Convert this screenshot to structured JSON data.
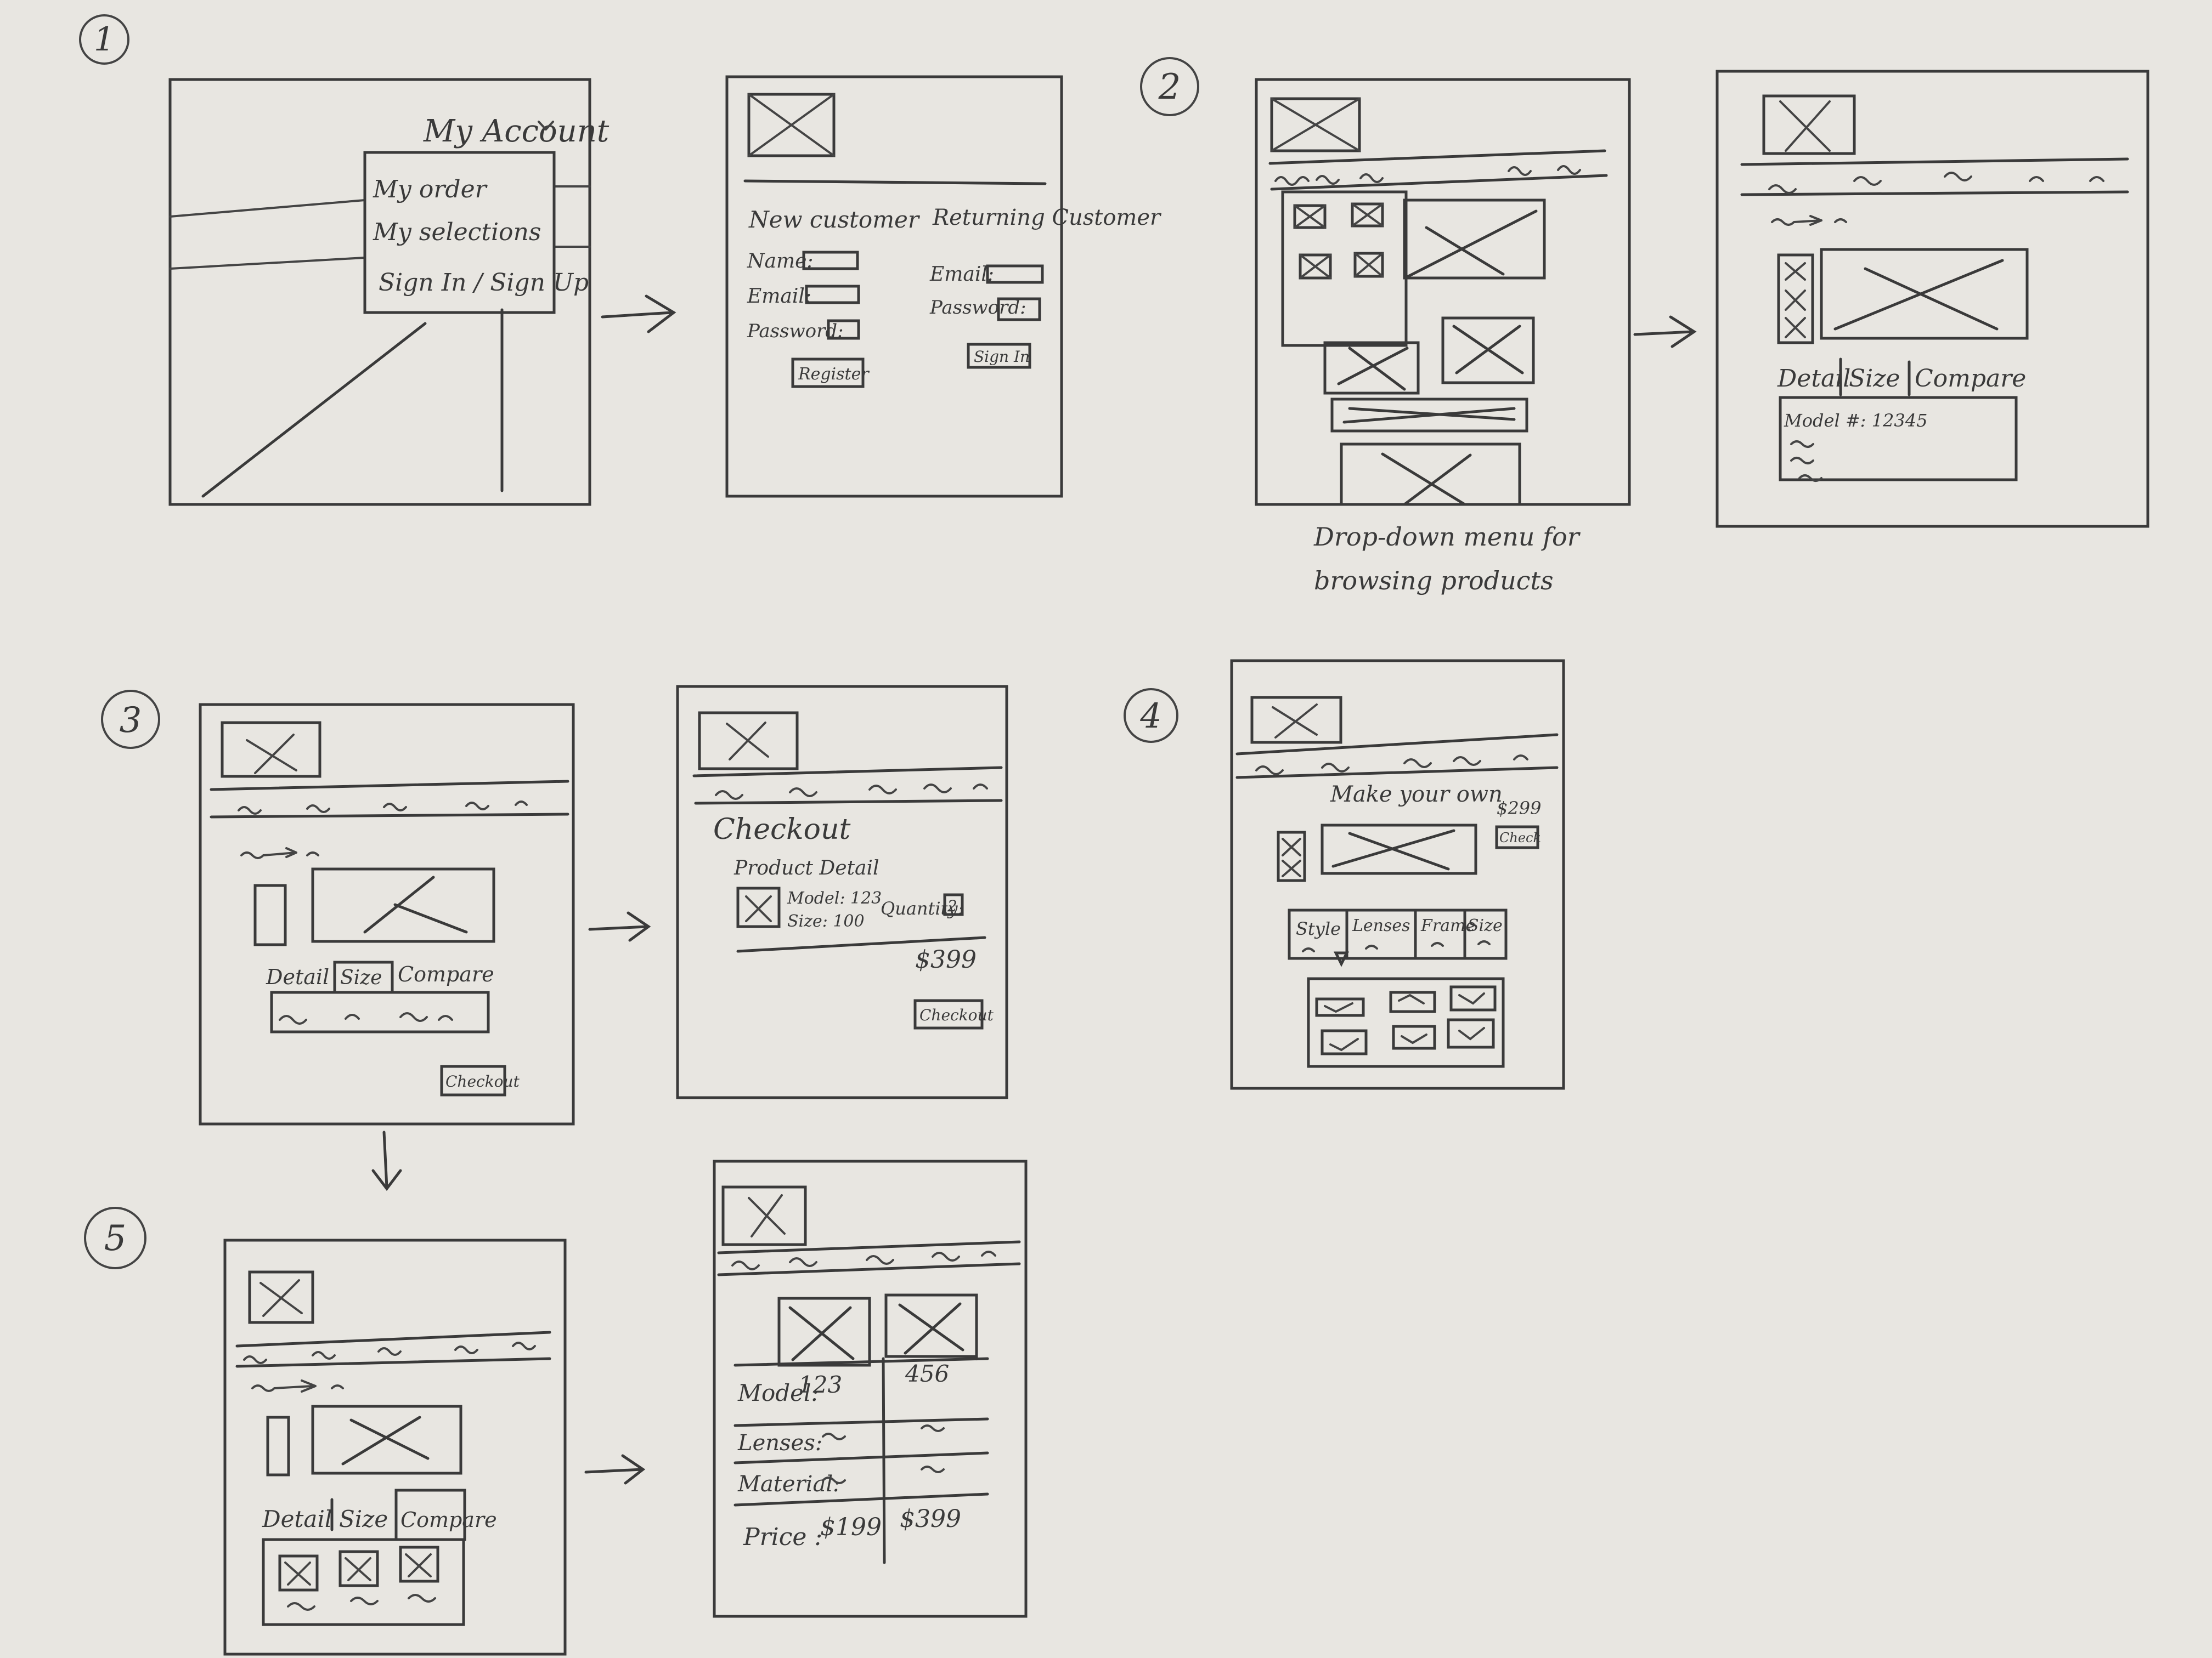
{
  "colors": {
    "paper": "#e8e6e1",
    "pencil": "#3a3a3a"
  },
  "steps": [
    "1",
    "2",
    "3",
    "4",
    "5"
  ],
  "account": {
    "menu_title": "My Account",
    "menu_items": [
      "My order",
      "My selections",
      "Sign In / Sign Up"
    ]
  },
  "login": {
    "new_customer": "New customer",
    "returning_customer": "Returning Customer",
    "name_label": "Name:",
    "email_label": "Email:",
    "password_label": "Password:",
    "email_label_2": "Email:",
    "password_label_2": "Password:",
    "register_button": "Register",
    "sign_in_button": "Sign In"
  },
  "browse": {
    "caption_line1": "Drop-down menu for",
    "caption_line2": "browsing products"
  },
  "product": {
    "tab_detail": "Detail",
    "tab_size": "Size",
    "tab_compare": "Compare",
    "model_text": "Model #: 12345"
  },
  "product3": {
    "tab_detail": "Detail",
    "tab_size": "Size",
    "tab_compare": "Compare",
    "checkout_button": "Checkout"
  },
  "checkout": {
    "title": "Checkout",
    "subtitle": "Product Detail",
    "model": "Model: 123",
    "size": "Size: 100",
    "quantity_label": "Quantity:",
    "quantity_value": "2",
    "price": "$399",
    "checkout_button": "Checkout"
  },
  "custom": {
    "title": "Make your own",
    "price": "$299",
    "checkout_button": "Check",
    "tabs": [
      "Style",
      "Lenses",
      "Frame",
      "Size"
    ]
  },
  "compare_page": {
    "tab_detail": "Detail",
    "tab_size": "Size",
    "tab_compare": "Compare"
  },
  "compare_table": {
    "model_label": "Model:",
    "model_a": "123",
    "model_b": "456",
    "lenses_label": "Lenses:",
    "material_label": "Material:",
    "price_label": "Price :",
    "price_a": "$199",
    "price_b": "$399"
  }
}
